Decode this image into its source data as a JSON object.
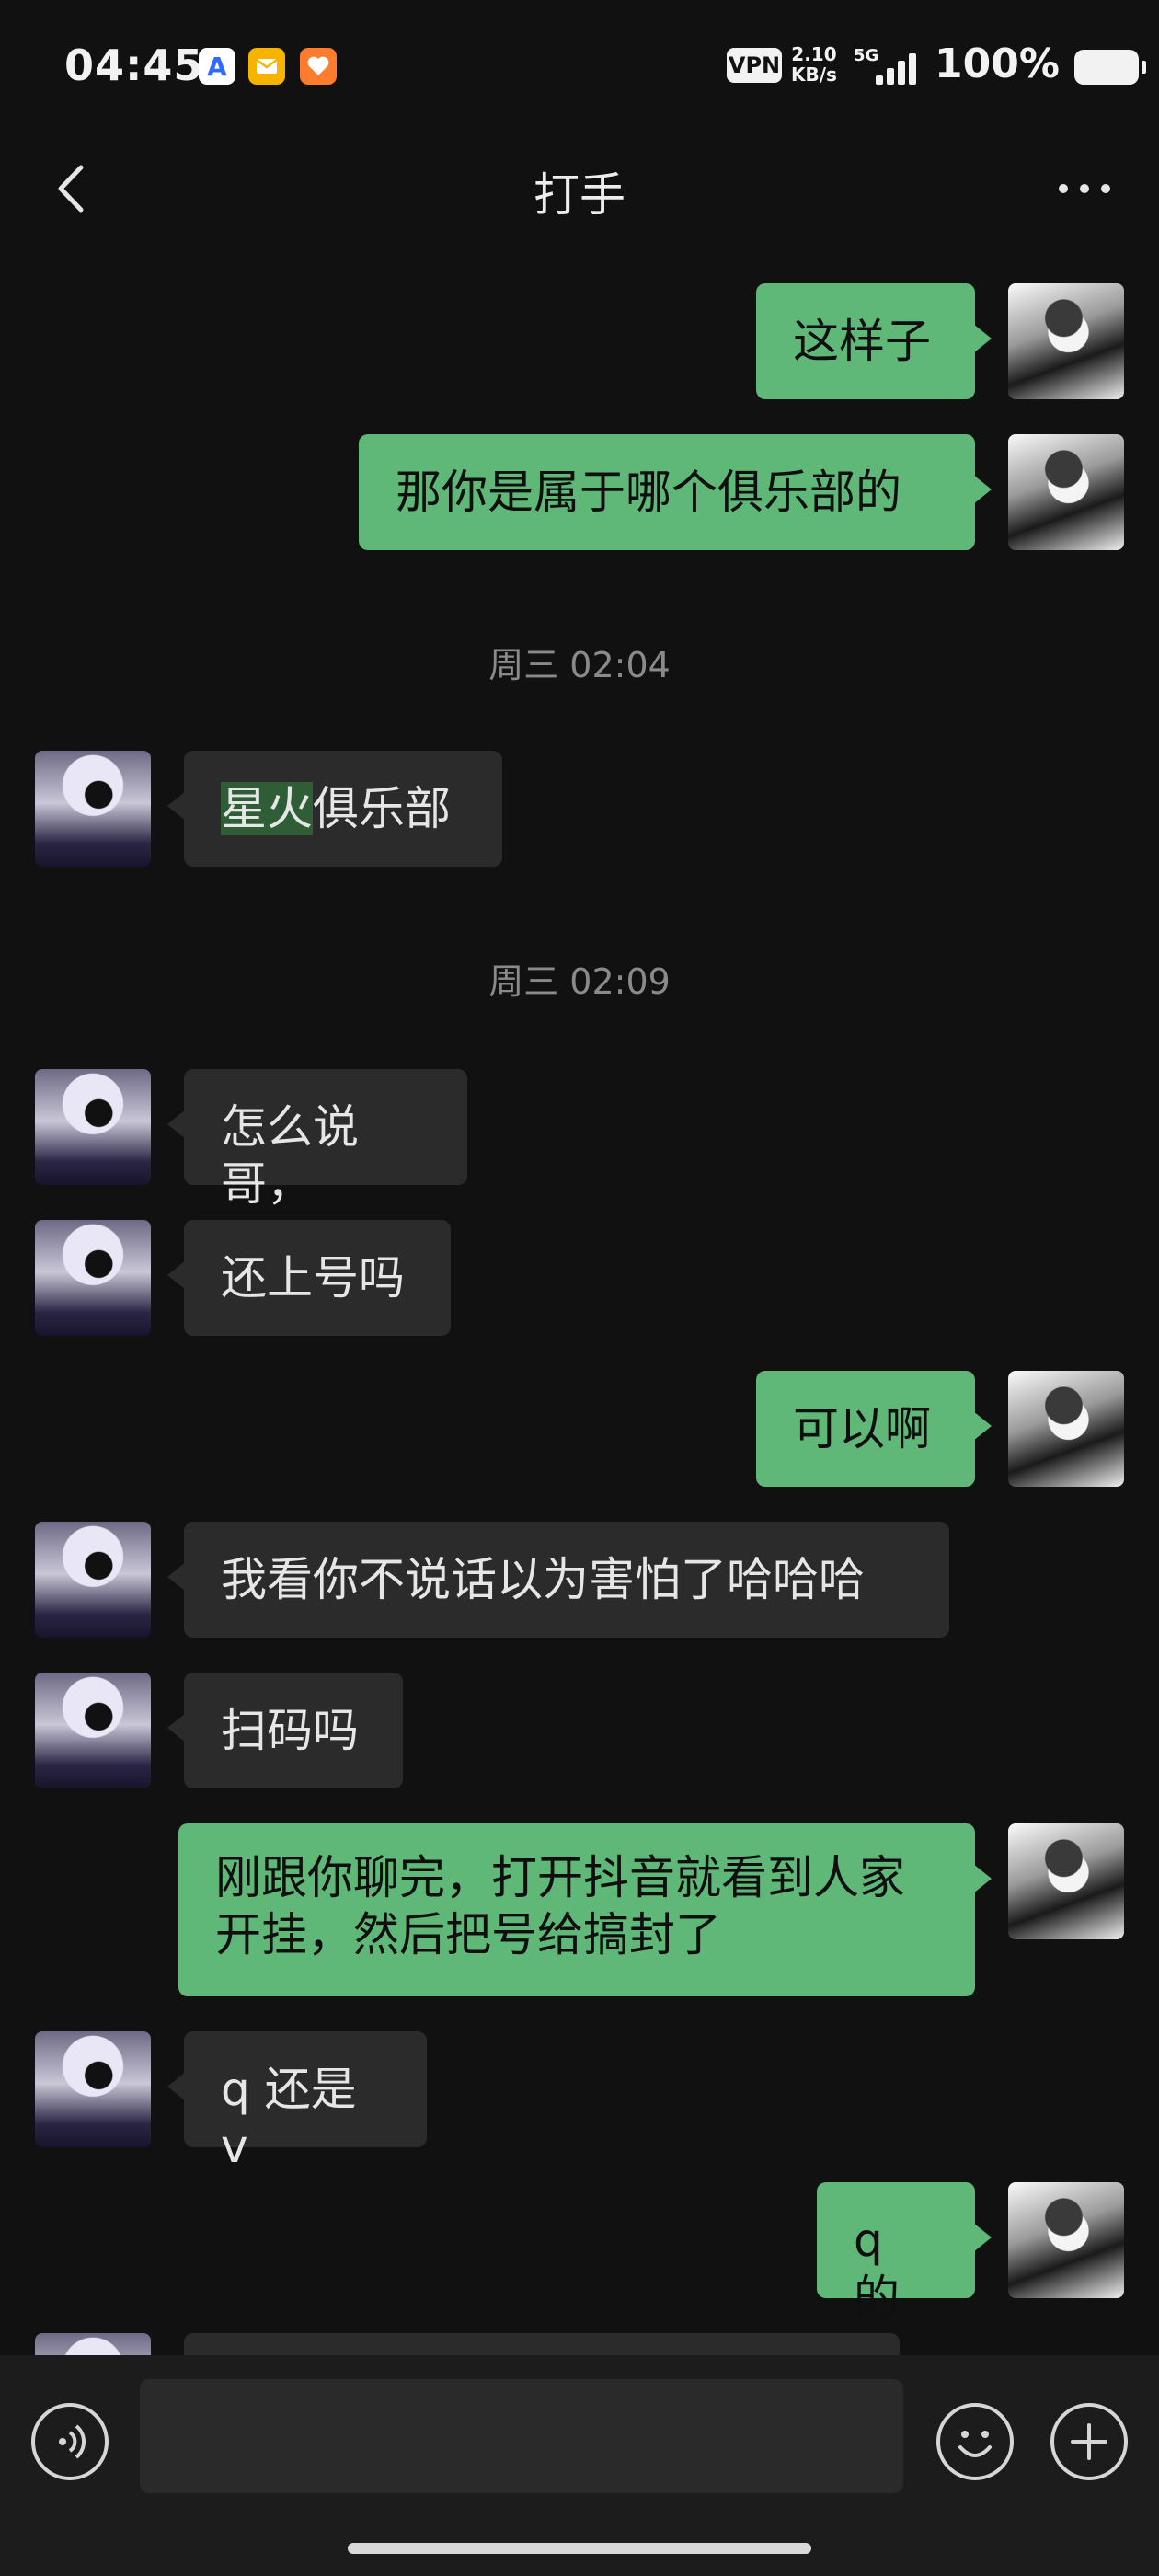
{
  "status_bar": {
    "time": "04:45",
    "vpn": "VPN",
    "speed_value": "2.10",
    "speed_unit": "KB/s",
    "network": "5G",
    "battery": "100%"
  },
  "header": {
    "title": "打手",
    "back_icon": "chevron-left-icon",
    "more_icon": "more-horizontal-icon"
  },
  "messages": [
    {
      "from": "me",
      "text": "这样子"
    },
    {
      "from": "me",
      "text": "那你是属于哪个俱乐部的"
    },
    {
      "type": "time",
      "text": "周三 02:04"
    },
    {
      "from": "other",
      "text_highlight": "星火",
      "text_rest": "俱乐部"
    },
    {
      "type": "time",
      "text": "周三 02:09"
    },
    {
      "from": "other",
      "text": "怎么说哥，"
    },
    {
      "from": "other",
      "text": "还上号吗"
    },
    {
      "from": "me",
      "text": "可以啊"
    },
    {
      "from": "other",
      "text": "我看你不说话以为害怕了哈哈哈"
    },
    {
      "from": "other",
      "text": "扫码吗"
    },
    {
      "from": "me",
      "line1": "刚跟你聊完，打开抖音就看到人家",
      "line2": "开挂，然后把号给搞封了"
    },
    {
      "from": "other",
      "text": "q 还是 v"
    },
    {
      "from": "me",
      "text": "q 的"
    }
  ],
  "input_bar": {
    "voice_icon": "voice-icon",
    "emoji_icon": "emoji-icon",
    "plus_icon": "plus-icon"
  },
  "colors": {
    "background": "#111111",
    "my_bubble": "#5fb878",
    "other_bubble": "#2b2b2b"
  }
}
